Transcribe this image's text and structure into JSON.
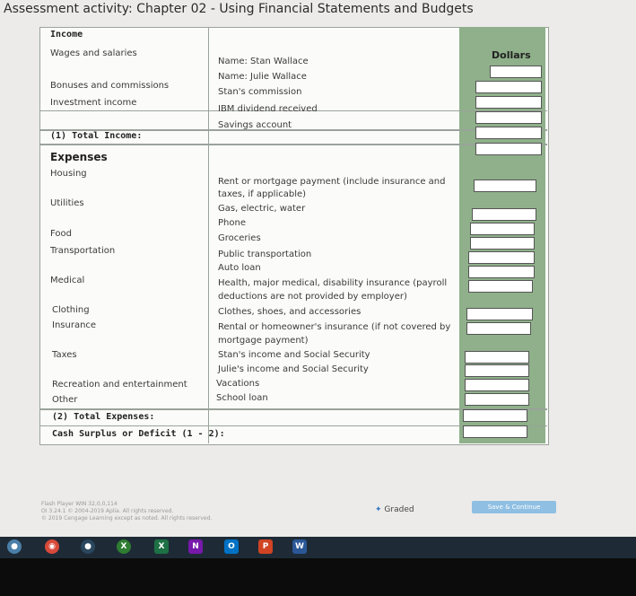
{
  "window_title": "Assessment activity: Chapter 02 - Using Financial Statements and Budgets",
  "income": {
    "heading": "Income",
    "dollars_header": "Dollars",
    "rows": [
      {
        "category": "Wages and salaries",
        "detail": "Name: Stan Wallace"
      },
      {
        "category": "",
        "detail": "Name: Julie Wallace"
      },
      {
        "category": "Bonuses and commissions",
        "detail": "Stan's commission"
      },
      {
        "category": "Investment income",
        "detail": "IBM dividend received"
      },
      {
        "category": "",
        "detail": "Savings account"
      }
    ],
    "total_label": "(1) Total Income:"
  },
  "expenses": {
    "heading": "Expenses",
    "rows": [
      {
        "category": "Housing",
        "detail_1": "Rent or mortgage payment (include insurance and",
        "detail_2": "taxes, if applicable)"
      },
      {
        "category": "Utilities",
        "detail_1": "Gas, electric, water"
      },
      {
        "category": "",
        "detail_1": "Phone"
      },
      {
        "category": "Food",
        "detail_1": "Groceries"
      },
      {
        "category": "Transportation",
        "detail_1": "Public transportation"
      },
      {
        "category": "",
        "detail_1": "Auto loan"
      },
      {
        "category": "Medical",
        "detail_1": "Health, major medical, disability insurance (payroll",
        "detail_2": "deductions are not provided by employer)"
      },
      {
        "category": "Clothing",
        "detail_1": "Clothes, shoes, and accessories"
      },
      {
        "category": "Insurance",
        "detail_1": "Rental or homeowner's insurance (if not covered by",
        "detail_2": "mortgage payment)"
      },
      {
        "category": "Taxes",
        "detail_1": "Stan's income and Social Security"
      },
      {
        "category": "",
        "detail_1": "Julie's income and Social Security"
      },
      {
        "category": "Recreation and entertainment",
        "detail_1": "Vacations"
      },
      {
        "category": "Other",
        "detail_1": "School loan"
      }
    ],
    "total_label": "(2) Total Expenses:"
  },
  "surplus_label": "Cash Surplus or Deficit (1 - 2):",
  "footer": {
    "line1": "Flash Player WIN 32,0,0,114",
    "line2": "OI 3.24.1 © 2004-2019 Aplia. All rights reserved.",
    "line3": "© 2019 Cengage Learning except as noted. All rights reserved.",
    "graded": "Graded",
    "save_button": "Save & Continue"
  },
  "taskbar_icons": [
    "windows-icon",
    "chrome-icon",
    "steam-icon",
    "xbox-icon",
    "excel-icon",
    "onenote-icon",
    "outlook-icon",
    "powerpoint-icon",
    "word-icon"
  ]
}
